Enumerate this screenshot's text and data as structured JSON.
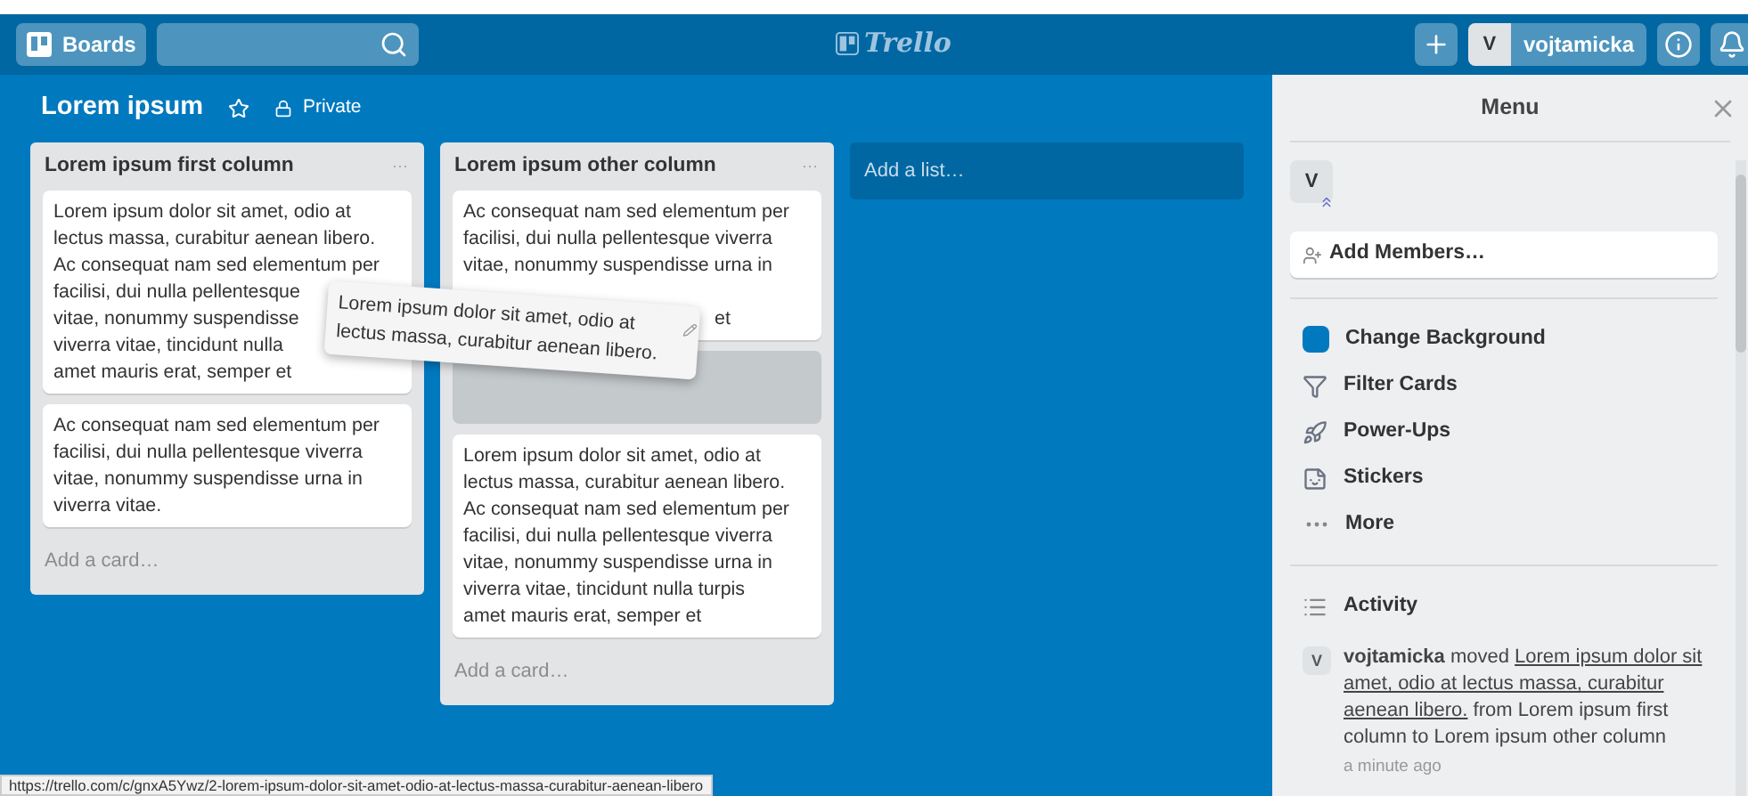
{
  "header": {
    "boards_label": "Boards",
    "logo": "Trello",
    "avatar_initial": "V",
    "username": "vojtamicka"
  },
  "board": {
    "title": "Lorem ipsum",
    "starred": false,
    "visibility": "Private"
  },
  "lists": [
    {
      "title": "Lorem ipsum first column",
      "menu": "···",
      "cards": [
        {
          "kind": "card",
          "lines": [
            "Lorem ipsum dolor sit amet, odio at",
            "lectus massa, curabitur aenean libero.",
            "Ac consequat nam sed elementum per",
            "facilisi, dui nulla pellentesque",
            "vitae, nonummy suspendisse",
            "viverra vitae, tincidunt nulla",
            "amet mauris erat, semper et"
          ]
        },
        {
          "kind": "card",
          "lines": [
            "Ac consequat nam sed elementum per",
            "facilisi, dui nulla pellentesque viverra",
            "vitae, nonummy suspendisse urna in",
            "viverra vitae."
          ]
        }
      ],
      "add_card": "Add a card…"
    },
    {
      "title": "Lorem ipsum other column",
      "menu": "···",
      "cards": [
        {
          "kind": "card",
          "lines": [
            "Ac consequat nam sed elementum per",
            "facilisi, dui nulla pellentesque viverra",
            "vitae, nonummy suspendisse urna in"
          ],
          "tail": "et"
        },
        {
          "kind": "placeholder"
        },
        {
          "kind": "card",
          "lines": [
            "Lorem ipsum dolor sit amet, odio at",
            "lectus massa, curabitur aenean libero.",
            "Ac consequat nam sed elementum per",
            "facilisi, dui nulla pellentesque viverra",
            "vitae, nonummy suspendisse urna in",
            "viverra vitae, tincidunt nulla turpis",
            "amet mauris erat, semper et"
          ]
        }
      ],
      "add_card": "Add a card…"
    }
  ],
  "add_list": "Add a list…",
  "dragged_card": {
    "text": "Lorem ipsum dolor sit amet, odio at lectus massa, curabitur aenean libero."
  },
  "menu": {
    "title": "Menu",
    "member_initial": "V",
    "add_members": "Add Members…",
    "items": [
      {
        "kind": "background",
        "label": "Change Background",
        "color": "#0079bf"
      },
      {
        "kind": "filter",
        "label": "Filter Cards"
      },
      {
        "kind": "powerups",
        "label": "Power-Ups"
      },
      {
        "kind": "stickers",
        "label": "Stickers"
      },
      {
        "kind": "more",
        "label": "More"
      }
    ],
    "activity_title": "Activity",
    "activity": [
      {
        "initial": "V",
        "user": "vojtamicka",
        "action": "moved",
        "card_lines": [
          "Lorem ipsum dolor sit",
          "amet, odio at lectus massa, curabitur",
          "aenean libero."
        ],
        "detail": "from Lorem ipsum first column to Lorem ipsum other column",
        "time": "a minute ago"
      }
    ]
  },
  "status_url": "https://trello.com/c/gnxA5Ywz/2-lorem-ipsum-dolor-sit-amet-odio-at-lectus-massa-curabitur-aenean-libero"
}
